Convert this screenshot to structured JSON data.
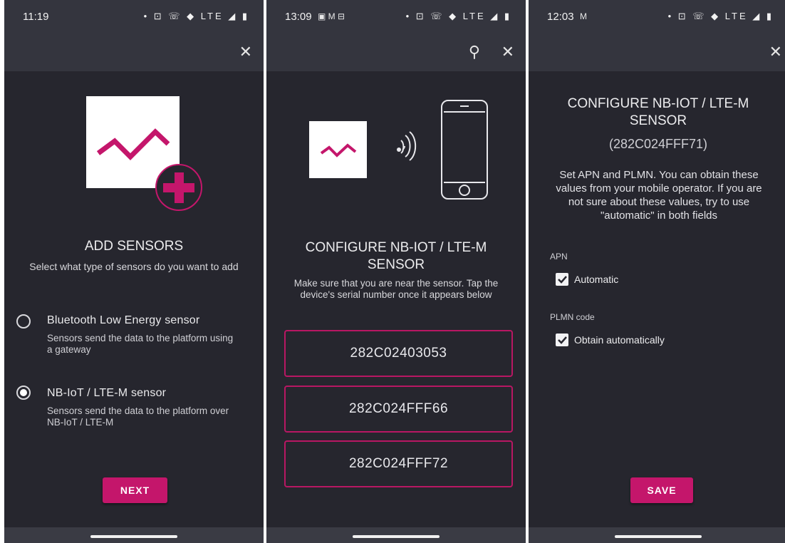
{
  "screens": [
    {
      "time": "11:19",
      "status_icons": "• ⊡ ☏ ◆ LTE ◢ ▮",
      "close_icon": "✕",
      "title": "ADD SENSORS",
      "subtitle": "Select what type of sensors do you want to add",
      "options": [
        {
          "label": "Bluetooth Low Energy sensor",
          "description": "Sensors send the data to the platform using a gateway",
          "selected": false
        },
        {
          "label": "NB-IoT / LTE-M sensor",
          "description": "Sensors send the data to the platform over NB-IoT / LTE-M",
          "selected": true
        }
      ],
      "button": "NEXT"
    },
    {
      "time": "13:09",
      "status_extra": "▣ M ⊟",
      "status_icons": "• ⊡ ☏ ◆ LTE ◢ ▮",
      "search_icon": "⚲",
      "close_icon": "✕",
      "nfc_icon": "((·",
      "title_line1": "CONFIGURE NB-IOT / LTE-M",
      "title_line2": "SENSOR",
      "subtitle": "Make sure that you are near the sensor. Tap the device's serial number once it appears below",
      "serials": [
        "282C02403053",
        "282C024FFF66",
        "282C024FFF72"
      ]
    },
    {
      "time": "12:03",
      "status_extra": "M",
      "status_icons": "• ⊡ ☏ ◆ LTE ◢ ▮",
      "close_icon": "✕",
      "title_line1": "CONFIGURE NB-IOT / LTE-M",
      "title_line2": "SENSOR",
      "serial": "(282C024FFF71)",
      "description": "Set APN and PLMN. You can obtain these values from your mobile operator. If you are not sure about these values, try to use \"automatic\" in both fields",
      "apn_label": "APN",
      "apn_checkbox": "Automatic",
      "plmn_label": "PLMN code",
      "plmn_checkbox": "Obtain automatically",
      "button": "SAVE"
    }
  ],
  "colors": {
    "accent": "#c4166b",
    "background": "#26262e",
    "toolbar": "#34353e"
  }
}
